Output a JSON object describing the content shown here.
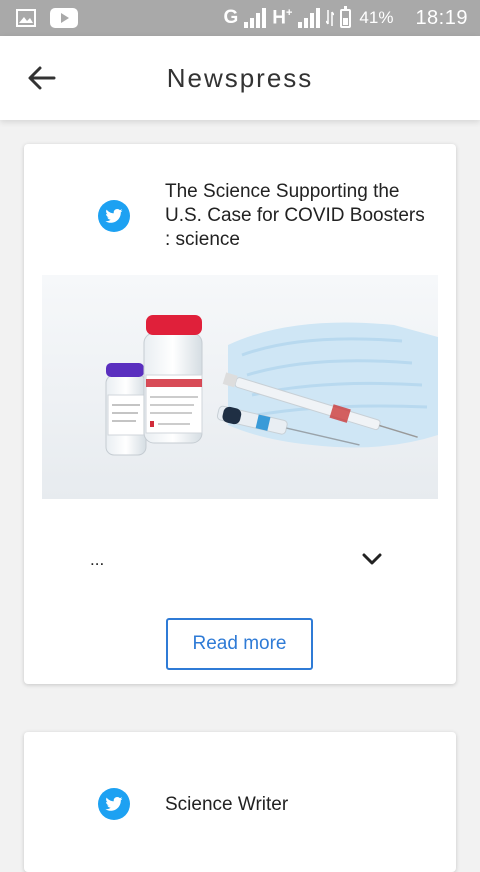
{
  "status_bar": {
    "network": "G",
    "network2": "H",
    "network2_sup": "+",
    "battery_percent": "41%",
    "time": "18:19",
    "icons": [
      "gallery-icon",
      "youtube-icon",
      "signal-icon",
      "battery-icon"
    ]
  },
  "app_bar": {
    "title": "Newspress",
    "back_icon": "arrow-left-icon"
  },
  "posts": [
    {
      "source_icon": "twitter-icon",
      "title": "The Science Supporting the U.S. Case for COVID Boosters : science",
      "image": "vaccine vials and syringes on face mask",
      "body_preview": "...",
      "expand_icon": "chevron-down-icon",
      "read_more_label": "Read more"
    },
    {
      "source_icon": "twitter-icon",
      "title": "Science Writer"
    }
  ],
  "colors": {
    "accent": "#2f7bd6",
    "twitter": "#1da1f2",
    "status_bar_bg": "#a9a9a9"
  }
}
